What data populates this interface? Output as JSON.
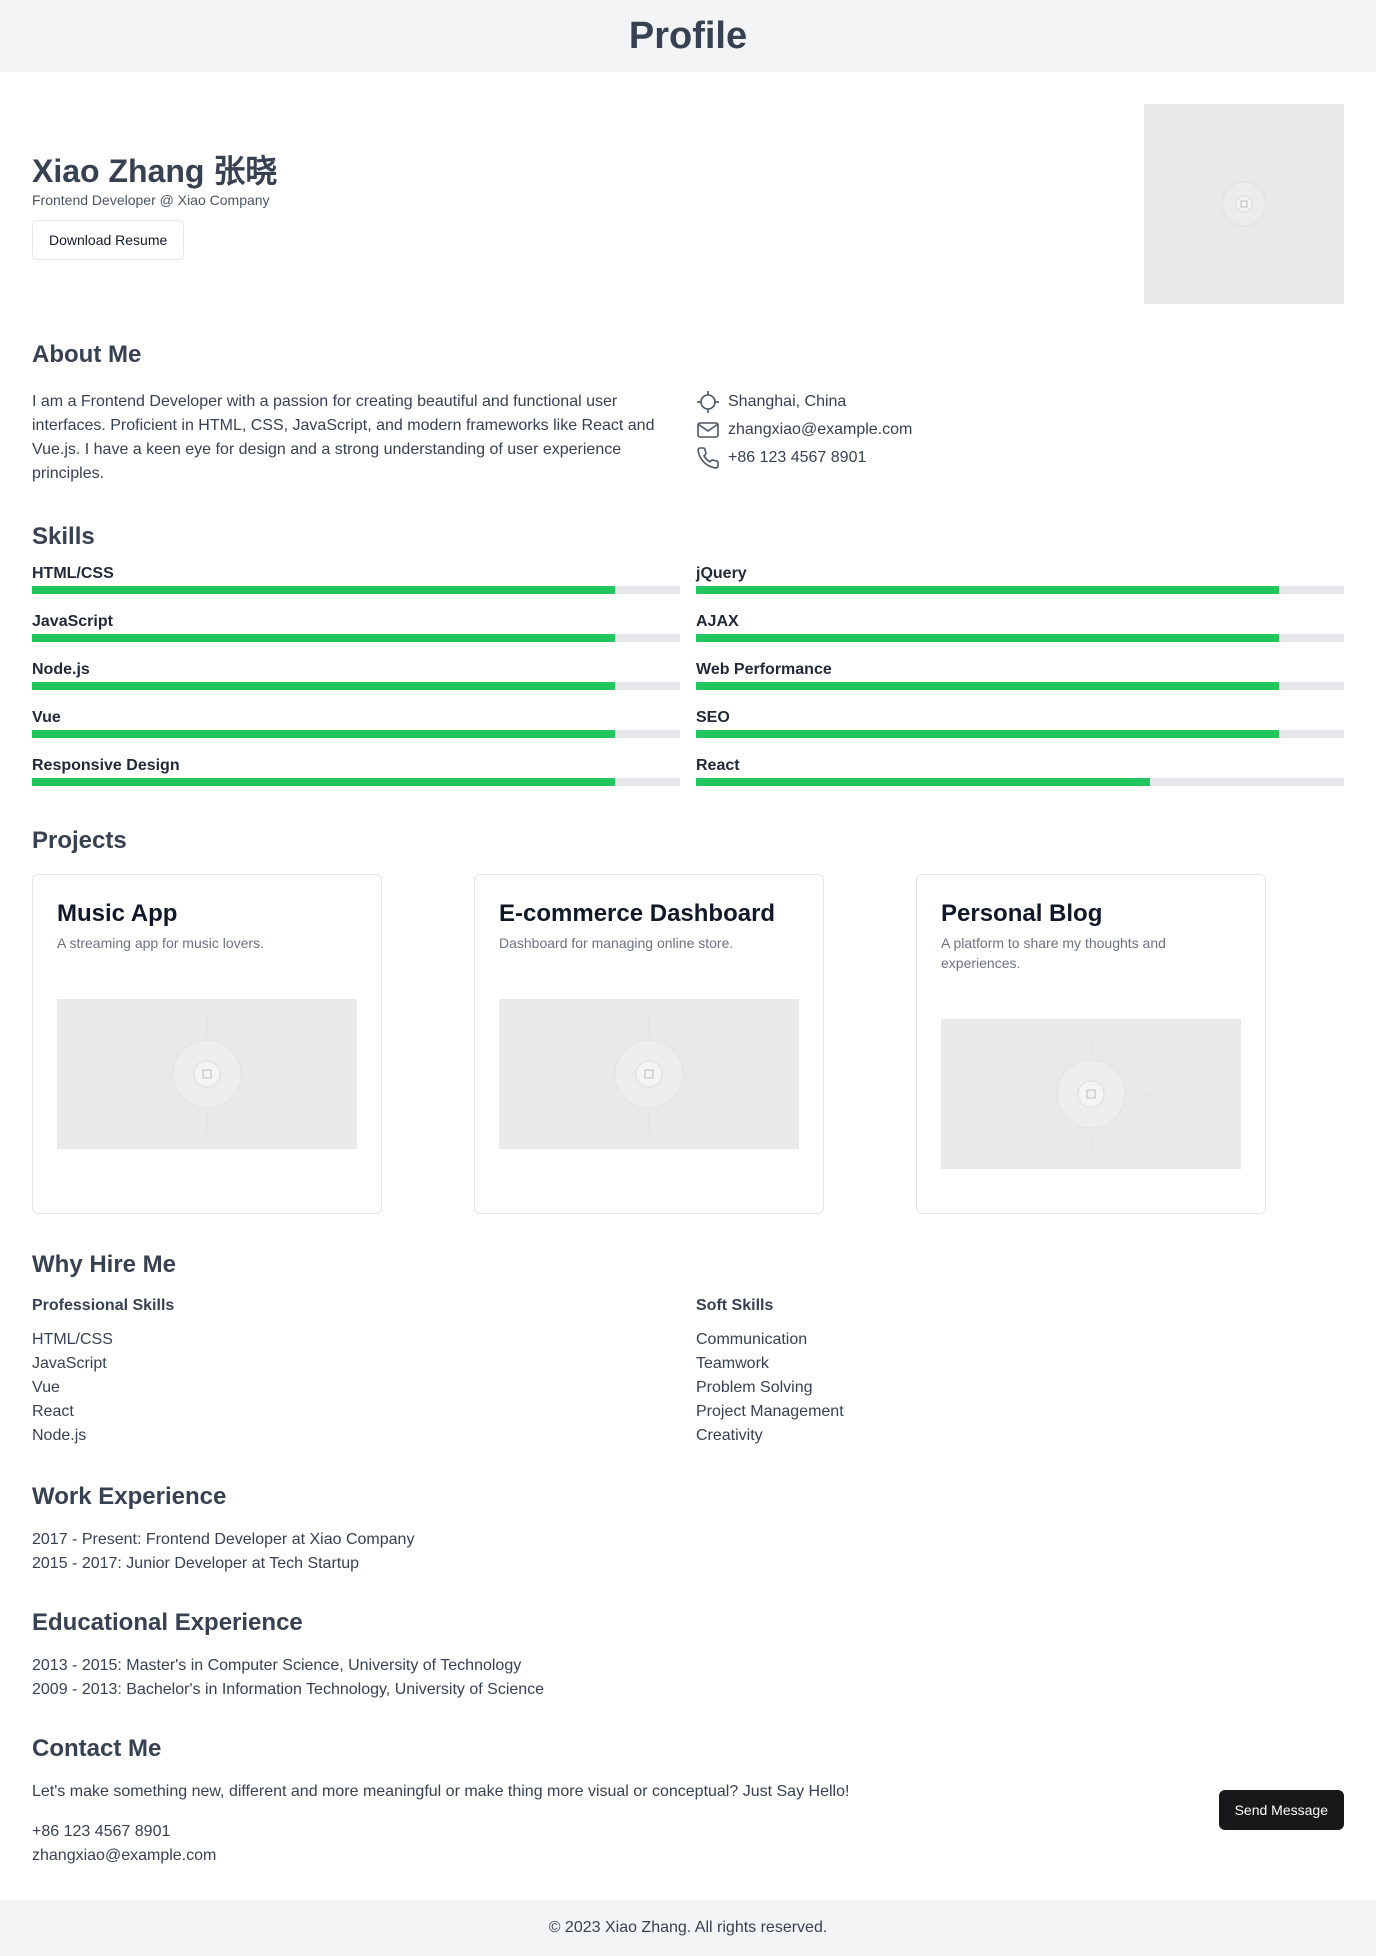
{
  "header": {
    "title": "Profile"
  },
  "hero": {
    "name": "Xiao Zhang 张晓",
    "subtitle": "Frontend Developer @ Xiao Company",
    "download_label": "Download Resume"
  },
  "about": {
    "title": "About Me",
    "text": "I am a Frontend Developer with a passion for creating beautiful and functional user interfaces. Proficient in HTML, CSS, JavaScript, and modern frameworks like React and Vue.js. I have a keen eye for design and a strong understanding of user experience principles.",
    "location": "Shanghai, China",
    "email": "zhangxiao@example.com",
    "phone": "+86 123 4567 8901"
  },
  "skills": {
    "title": "Skills",
    "items": [
      {
        "name": "HTML/CSS",
        "level": 0.9
      },
      {
        "name": "jQuery",
        "level": 0.9
      },
      {
        "name": "JavaScript",
        "level": 0.9
      },
      {
        "name": "AJAX",
        "level": 0.9
      },
      {
        "name": "Node.js",
        "level": 0.9
      },
      {
        "name": "Web Performance",
        "level": 0.9
      },
      {
        "name": "Vue",
        "level": 0.9
      },
      {
        "name": "SEO",
        "level": 0.9
      },
      {
        "name": "Responsive Design",
        "level": 0.9
      },
      {
        "name": "React",
        "level": 0.7
      }
    ],
    "fill_color": "#22c55e"
  },
  "projects": {
    "title": "Projects",
    "items": [
      {
        "title": "Music App",
        "description": "A streaming app for music lovers."
      },
      {
        "title": "E-commerce Dashboard",
        "description": "Dashboard for managing online store."
      },
      {
        "title": "Personal Blog",
        "description": "A platform to share my thoughts and experiences."
      }
    ]
  },
  "why": {
    "title": "Why Hire Me",
    "professional_title": "Professional Skills",
    "professional": [
      "HTML/CSS",
      "JavaScript",
      "Vue",
      "React",
      "Node.js"
    ],
    "soft_title": "Soft Skills",
    "soft": [
      "Communication",
      "Teamwork",
      "Problem Solving",
      "Project Management",
      "Creativity"
    ]
  },
  "work": {
    "title": "Work Experience",
    "items": [
      "2017 - Present: Frontend Developer at Xiao Company",
      "2015 - 2017: Junior Developer at Tech Startup"
    ]
  },
  "education": {
    "title": "Educational Experience",
    "items": [
      "2013 - 2015: Master's in Computer Science, University of Technology",
      "2009 - 2013: Bachelor's in Information Technology, University of Science"
    ]
  },
  "contact": {
    "title": "Contact Me",
    "message": "Let's make something new, different and more meaningful or make thing more visual or conceptual? Just Say Hello!",
    "phone": "+86 123 4567 8901",
    "email": "zhangxiao@example.com",
    "send_label": "Send Message"
  },
  "footer": {
    "text": "© 2023 Xiao Zhang. All rights reserved."
  }
}
